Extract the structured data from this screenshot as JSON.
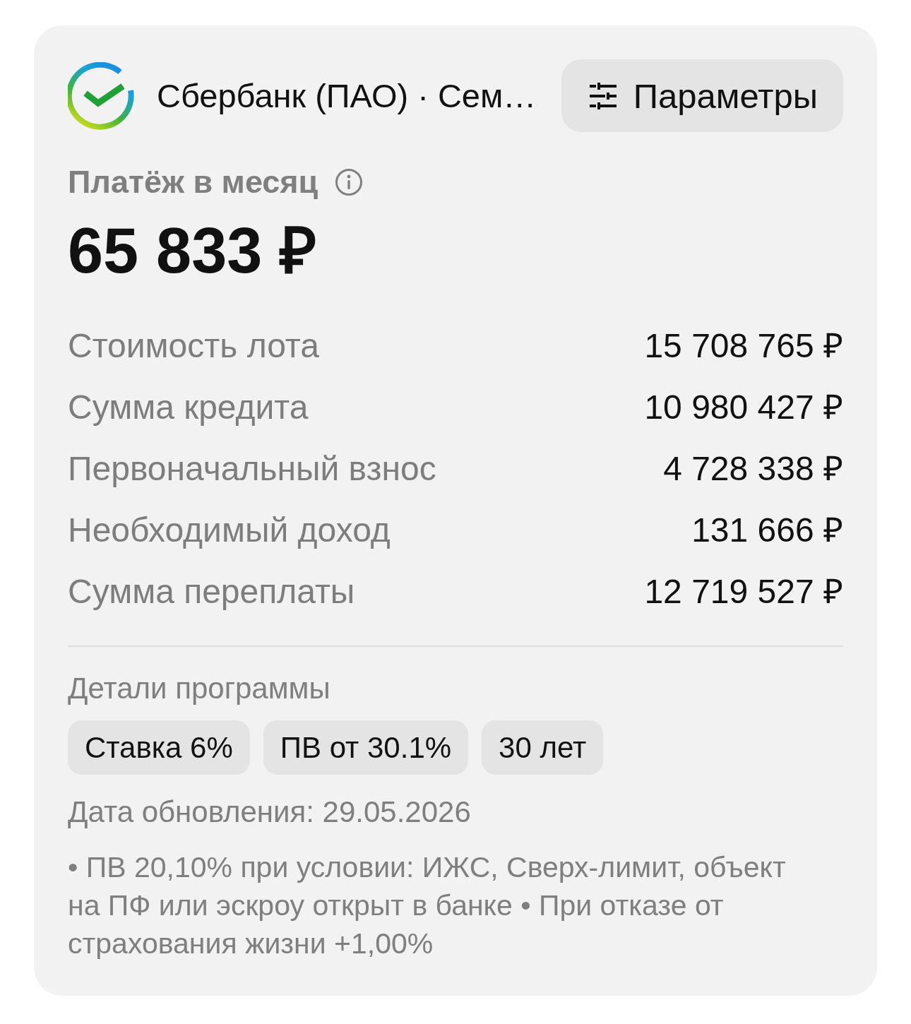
{
  "header": {
    "bank_name": "Сбербанк (ПАО) · Сем…",
    "parameters_button": "Параметры"
  },
  "payment": {
    "label": "Платёж в месяц",
    "amount": "65 833 ₽"
  },
  "summary_rows": [
    {
      "label": "Стоимость лота",
      "value": "15 708 765 ₽"
    },
    {
      "label": "Сумма кредита",
      "value": "10 980 427 ₽"
    },
    {
      "label": "Первоначальный взнос",
      "value": "4 728 338 ₽"
    },
    {
      "label": "Необходимый доход",
      "value": "131 666 ₽"
    },
    {
      "label": "Сумма переплаты",
      "value": "12 719 527 ₽"
    }
  ],
  "program_details": {
    "title": "Детали программы",
    "tags": [
      "Ставка 6%",
      "ПВ от 30.1%",
      "30 лет"
    ]
  },
  "update_date": "Дата обновления: 29.05.2026",
  "footnote": "• ПВ 20,10% при условии: ИЖС, Сверх-лимит, объект на ПФ или эскроу открыт в банке • При отказе от страхования жизни +1,00%"
}
